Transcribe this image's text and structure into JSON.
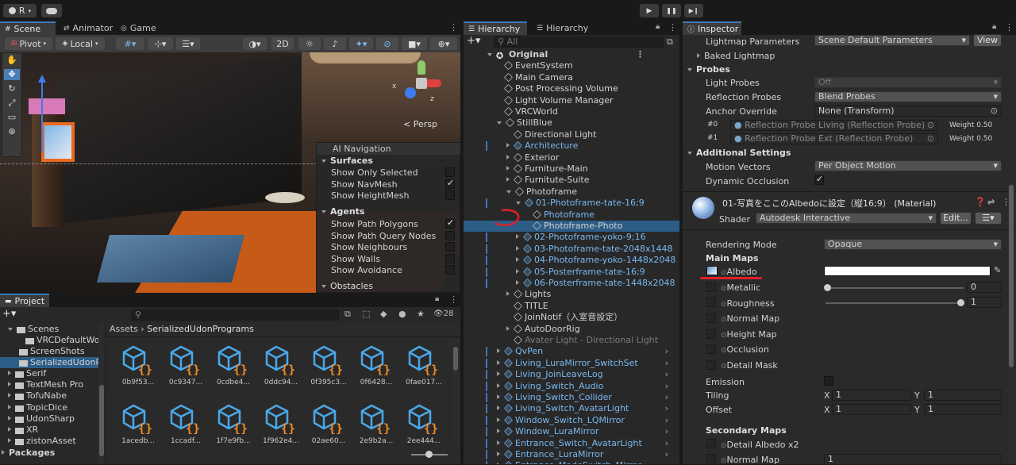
{
  "toolbar": {
    "account": "R",
    "play": "▶",
    "pause": "❚❚",
    "step": "▶❙"
  },
  "scene": {
    "tabs": [
      "Scene",
      "Animator",
      "Game"
    ],
    "pivot": "Pivot",
    "local": "Local",
    "mode2d": "2D",
    "persp": "< Persp"
  },
  "navigation": {
    "title": "AI Navigation",
    "surfaces": "Surfaces",
    "surface_items": [
      {
        "label": "Show Only Selected",
        "on": false
      },
      {
        "label": "Show NavMesh",
        "on": true
      },
      {
        "label": "Show HeightMesh",
        "on": false
      }
    ],
    "agents": "Agents",
    "agent_items": [
      {
        "label": "Show Path Polygons",
        "on": true
      },
      {
        "label": "Show Path Query Nodes",
        "on": false
      },
      {
        "label": "Show Neighbours",
        "on": false
      },
      {
        "label": "Show Walls",
        "on": false
      },
      {
        "label": "Show Avoidance",
        "on": false
      }
    ],
    "obstacles": "Obstacles"
  },
  "project": {
    "tab": "Project",
    "count": "28",
    "breadcrumb": [
      "Assets",
      "SerializedUdonPrograms"
    ],
    "folders": [
      "Scenes",
      "VRCDefaultWo",
      "ScreenShots",
      "SerializedUdonP",
      "Serif",
      "TextMesh Pro",
      "TofuNabe",
      "TopicDice",
      "UdonSharp",
      "XR",
      "zistonAsset",
      "Packages"
    ],
    "assets_row1": [
      "0b9f53...",
      "0c9347...",
      "0cdbe4...",
      "0ddc94...",
      "0f395c3...",
      "0f6428...",
      "0fae017..."
    ],
    "assets_row2": [
      "1acedb...",
      "1ccadf...",
      "1f7e9fb...",
      "1f962e4...",
      "02ae60...",
      "2e9b2a...",
      "2ee444..."
    ]
  },
  "hierarchy": {
    "tabs": [
      "Hierarchy",
      "Hierarchy"
    ],
    "search_placeholder": "All",
    "items": [
      "Original",
      "EventSystem",
      "Main Camera",
      "Post Processing Volume",
      "Light Volume Manager",
      "VRCWorld",
      "StillBlue",
      "Directional Light",
      "Architecture",
      "Exterior",
      "Furniture-Main",
      "Furnitute-Suite",
      "Photoframe",
      "01-Photoframe-tate-16;9",
      "Photoframe",
      "Photoframe-Photo",
      "02-Photoframe-yoko-9;16",
      "03-Photoframe-tate-2048x1448",
      "04-Photoframe-yoko-1448x2048",
      "05-Posterframe-tate-16;9",
      "06-Posterframe-tate-1448x2048",
      "Lights",
      "TITLE",
      "JoinNotif（入室音設定）",
      "AutoDoorRig",
      "Avater Light - Directional Light",
      "QvPen",
      "Living_LuraMirror_SwitchSet",
      "Living_JoinLeaveLog",
      "Living_Switch_Audio",
      "Living_Switch_Collider",
      "Living_Switch_AvatarLight",
      "Window_Switch_LQMirror",
      "Window_LuraMirror",
      "Entrance_Switch_AvatarLight",
      "Entrance_LuraMirror",
      "Entrance_ModeSwitch_Mirror"
    ]
  },
  "inspector": {
    "tab": "Inspector",
    "lightmap_label": "Lightmap Parameters",
    "lightmap_value": "Scene Default Parameters",
    "view": "View",
    "baked": "Baked Lightmap",
    "probes": "Probes",
    "light_probes_label": "Light Probes",
    "light_probes_value": "Off",
    "refl_label": "Reflection Probes",
    "refl_value": "Blend Probes",
    "anchor_label": "Anchor Override",
    "anchor_value": "None (Transform)",
    "probe0_idx": "#0",
    "probe0": "Reflection Probe Living (Reflection Probe)",
    "probe0_w": "Weight 0.50",
    "probe1_idx": "#1",
    "probe1": "Reflection Probe Ext (Reflection Probe)",
    "probe1_w": "Weight 0.50",
    "additional": "Additional Settings",
    "motion_label": "Motion Vectors",
    "motion_value": "Per Object Motion",
    "occl_label": "Dynamic Occlusion",
    "material_name": "01-写真をここのAlbedoに設定（縦16;9） (Material)",
    "shader_label": "Shader",
    "shader_value": "Autodesk Interactive",
    "edit": "Edit...",
    "rendering_label": "Rendering Mode",
    "rendering_value": "Opaque",
    "main_maps": "Main Maps",
    "albedo": "Albedo",
    "metallic": "Metallic",
    "metallic_value": "0",
    "roughness": "Roughness",
    "roughness_value": "1",
    "normal": "Normal Map",
    "height": "Height Map",
    "occlusion": "Occlusion",
    "detail_mask": "Detail Mask",
    "emission": "Emission",
    "tiling": "Tiling",
    "offset": "Offset",
    "x": "X",
    "y": "Y",
    "tiling_x": "1",
    "tiling_y": "1",
    "offset_x": "1",
    "offset_y": "1",
    "secondary": "Secondary Maps",
    "detail_albedo": "Detail Albedo x2",
    "normal2": "Normal Map",
    "normal2_value": "1"
  },
  "colors": {
    "accent": "#3a79bb",
    "selection": "#2c5d87",
    "link_blue": "#79b8f0",
    "annotation": "#e0202a"
  }
}
